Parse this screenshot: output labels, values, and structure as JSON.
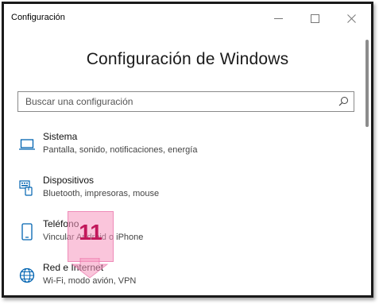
{
  "window": {
    "title": "Configuración",
    "controls": [
      "minimize",
      "maximize",
      "close"
    ]
  },
  "heading": "Configuración de Windows",
  "search": {
    "placeholder": "Buscar una configuración",
    "icon": "search-icon"
  },
  "categories": [
    {
      "title": "Sistema",
      "description": "Pantalla, sonido, notificaciones, energía",
      "icon": "laptop-icon"
    },
    {
      "title": "Dispositivos",
      "description": "Bluetooth, impresoras, mouse",
      "icon": "keyboard-icon"
    },
    {
      "title": "Teléfono",
      "description": "Vincular Android o iPhone",
      "icon": "phone-icon"
    },
    {
      "title": "Red e Internet",
      "description": "Wi-Fi, modo avión, VPN",
      "icon": "globe-icon"
    }
  ],
  "annotation": {
    "number": "11",
    "color": "#f596be",
    "text_color": "#c2185b"
  },
  "colors": {
    "accent": "#0063b1",
    "frame": "#1a1a1a"
  }
}
